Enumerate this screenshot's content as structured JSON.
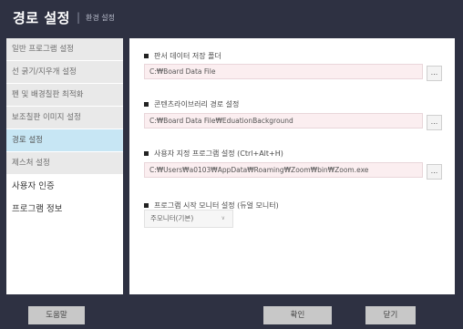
{
  "header": {
    "title": "경로 설정",
    "separator": "|",
    "subtitle": "환경 설정"
  },
  "sidebar": {
    "items": [
      {
        "label": "일반 프로그램 설정"
      },
      {
        "label": "선 굵기/지우개 설정"
      },
      {
        "label": "펜 및 배경칠판 최적화"
      },
      {
        "label": "보조칠판 이미지 설정"
      },
      {
        "label": "경로 설정"
      },
      {
        "label": "제스처 설정"
      },
      {
        "label": "사용자 인증"
      },
      {
        "label": "프로그램 정보"
      }
    ]
  },
  "main": {
    "sections": [
      {
        "heading": "판서 데이터 저장 폴더",
        "value": "C:₩Board Data File",
        "browse_label": "..."
      },
      {
        "heading": "콘텐츠라이브러리 경로 설정",
        "value": "C:₩Board Data File₩EduationBackground",
        "browse_label": "..."
      },
      {
        "heading": "사용자 지정 프로그램 설정 (Ctrl+Alt+H)",
        "value": "C:₩Users₩a0103₩AppData₩Roaming₩Zoom₩bin₩Zoom.exe",
        "browse_label": "..."
      }
    ],
    "monitor": {
      "heading": "프로그램 시작 모니터 설정 (듀얼 모니터)",
      "selected": "주모니터(기본)",
      "chevron": "∨"
    }
  },
  "footer": {
    "help": "도움말",
    "ok": "확인",
    "close": "닫기"
  },
  "colors": {
    "background": "#2e3142",
    "active_item": "#c7e6f4",
    "field_bg": "#fbeef0",
    "button_bg": "#c8c8c8"
  }
}
